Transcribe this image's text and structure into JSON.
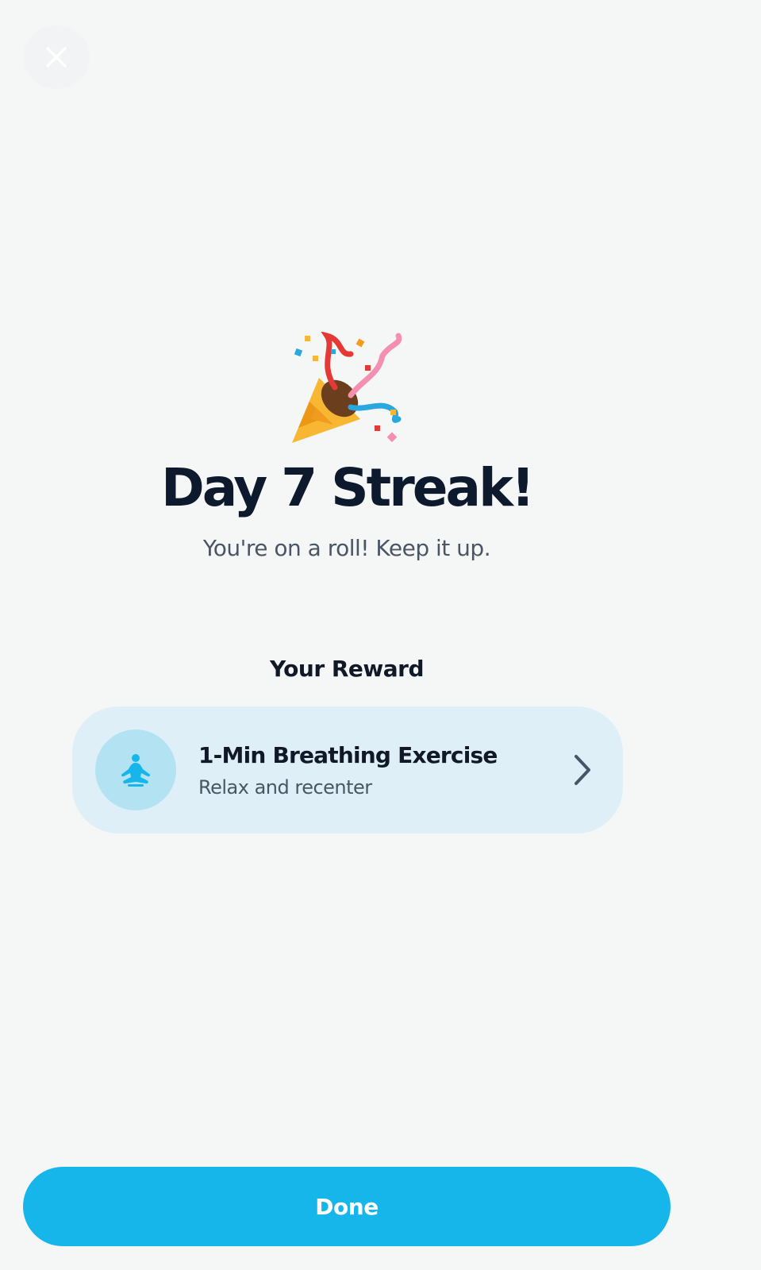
{
  "header": {
    "close_icon": "close-icon"
  },
  "hero": {
    "emoji": "🎉",
    "title": "Day 7 Streak!",
    "subtitle": "You're on a roll! Keep it up."
  },
  "reward": {
    "heading": "Your Reward",
    "card": {
      "icon": "meditation-icon",
      "title": "1-Min Breathing Exercise",
      "subtitle": "Relax and recenter",
      "chevron_icon": "chevron-right-icon"
    }
  },
  "footer": {
    "done_label": "Done"
  },
  "colors": {
    "background": "#f5f7f7",
    "accent": "#16b6ea",
    "card_bg": "#deeff7",
    "icon_circle": "#b3e3f3",
    "title_text": "#0d1a2d"
  }
}
